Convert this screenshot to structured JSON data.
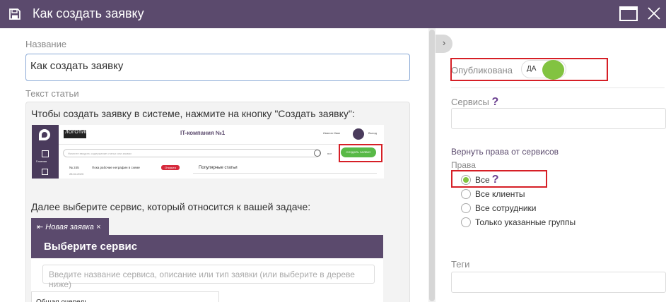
{
  "window": {
    "title": "Как создать заявку"
  },
  "left": {
    "name_label": "Название",
    "name_value": "Как создать заявку",
    "text_label": "Текст статьи",
    "paragraph1": "Чтобы создать заявку в системе, нажмите на кнопку \"Создать заявку\":",
    "paragraph2": "Далее выберите сервис, который относится к вашей задаче:",
    "shot1": {
      "logotype": "ЛОГОТИП",
      "company": "IT-компания №1",
      "user": "Иванов Иван",
      "exit": "Выход",
      "side_label": "Главная",
      "search_placeholder": "Начните вводить содержание статьи или заявки",
      "all_link": "все",
      "create_button": "СОЗДАТЬ ЗАЯВКУ",
      "row_id": "№ 245",
      "row_date": "28.04.2023",
      "row_text": "Пока рабочие неграфин в\nсхеме",
      "row_badge": "Открыта",
      "popular": "Популярные статьи"
    },
    "shot2": {
      "tab_label": "Новая заявка",
      "heading": "Выберите сервис",
      "search_placeholder": "Введите название сервиса, описание или тип заявки (или выберите в дереве ниже)",
      "queue": "Общая очередь"
    }
  },
  "right": {
    "collapse_glyph": "›",
    "published_label": "Опубликована",
    "published_value": "ДА",
    "services_label": "Сервисы",
    "help_glyph": "?",
    "return_rights_label": "Вернуть права от сервисов",
    "rights_label": "Права",
    "options": [
      {
        "label": "Все",
        "checked": true
      },
      {
        "label": "Все клиенты",
        "checked": false
      },
      {
        "label": "Все сотрудники",
        "checked": false
      },
      {
        "label": "Только указанные группы",
        "checked": false
      }
    ],
    "tags_label": "Теги"
  },
  "colors": {
    "titlebar": "#5b4a6d",
    "accent_green": "#82c341",
    "highlight_red": "#d61f26",
    "help_purple": "#6a3f8f"
  },
  "icons": {
    "save": "floppy-disk-icon",
    "maximize": "maximize-icon",
    "close": "close-icon",
    "collapse": "chevron-right-icon"
  }
}
